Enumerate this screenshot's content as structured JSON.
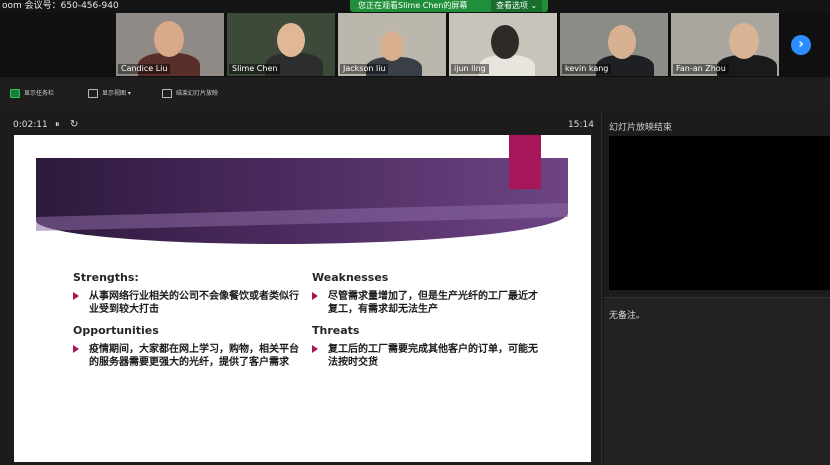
{
  "topbar": {
    "meeting_id": "oom 会议号：650-456-940",
    "viewing_banner": "您正在观看Slime Chen的屏幕",
    "view_options": "查看选项 ⌄"
  },
  "participants": [
    {
      "name": "Candice Liu"
    },
    {
      "name": "Slime Chen"
    },
    {
      "name": "Jackson liu"
    },
    {
      "name": "ijun ling"
    },
    {
      "name": "kevin kang"
    },
    {
      "name": "Fan-an Zhou"
    }
  ],
  "toolbar": {
    "btn1": "显示任务栏",
    "btn2": "显示视图 ▾",
    "btn3": "结束幻灯片放映"
  },
  "presenter": {
    "elapsed": "0:02:11",
    "pause": "⏸",
    "restart": "↻",
    "clock": "15:14",
    "next_slide_label": "幻灯片放映结束",
    "notes": "无备注。"
  },
  "slide": {
    "strengths": {
      "title": "Strengths:",
      "items": [
        "从事网络行业相关的公司不会像餐饮或者类似行业受到较大打击"
      ]
    },
    "weaknesses": {
      "title": "Weaknesses",
      "items": [
        "尽管需求量增加了，但是生产光纤的工厂最近才复工，有需求却无法生产"
      ]
    },
    "opportunities": {
      "title": "Opportunities",
      "items": [
        "疫情期间，大家都在网上学习，购物，相关平台的服务器需要更强大的光纤，提供了客户需求"
      ]
    },
    "threats": {
      "title": "Threats",
      "items": [
        "复工后的工厂需要完成其他客户的订单，可能无法按时交货"
      ]
    },
    "accent_color": "#a7155b"
  }
}
